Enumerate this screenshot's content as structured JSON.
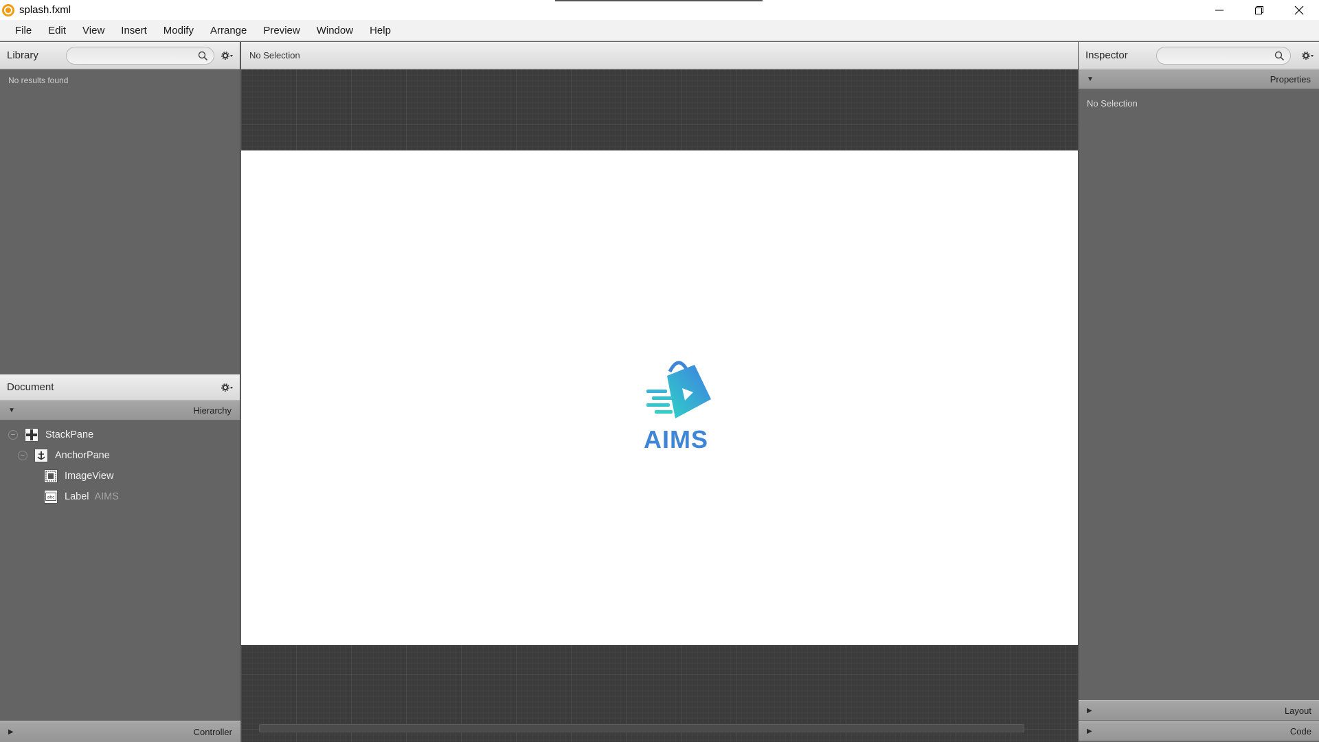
{
  "window": {
    "title": "splash.fxml",
    "icon": "scene-builder-icon",
    "controls": [
      "minimize-icon",
      "restore-icon",
      "close-icon"
    ]
  },
  "menu": {
    "items": [
      "File",
      "Edit",
      "View",
      "Insert",
      "Modify",
      "Arrange",
      "Preview",
      "Window",
      "Help"
    ]
  },
  "library": {
    "title": "Library",
    "search_placeholder": "",
    "empty_text": "No results found"
  },
  "document": {
    "title": "Document",
    "section": "Hierarchy",
    "tree": [
      {
        "label": "StackPane",
        "extra": ""
      },
      {
        "label": "AnchorPane",
        "extra": ""
      },
      {
        "label": "ImageView",
        "extra": ""
      },
      {
        "label": "Label",
        "extra": "AIMS"
      }
    ],
    "controller_label": "Controller"
  },
  "content": {
    "selection_status": "No Selection",
    "logo_text": "AIMS"
  },
  "inspector": {
    "title": "Inspector",
    "search_placeholder": "",
    "properties_label": "Properties",
    "no_selection": "No Selection",
    "layout_label": "Layout",
    "code_label": "Code"
  },
  "colors": {
    "panel_bg": "#646464",
    "canvas_bg": "#3c3c3c",
    "logo_blue": "#3f86d6",
    "logo_teal": "#2fd2c8"
  }
}
